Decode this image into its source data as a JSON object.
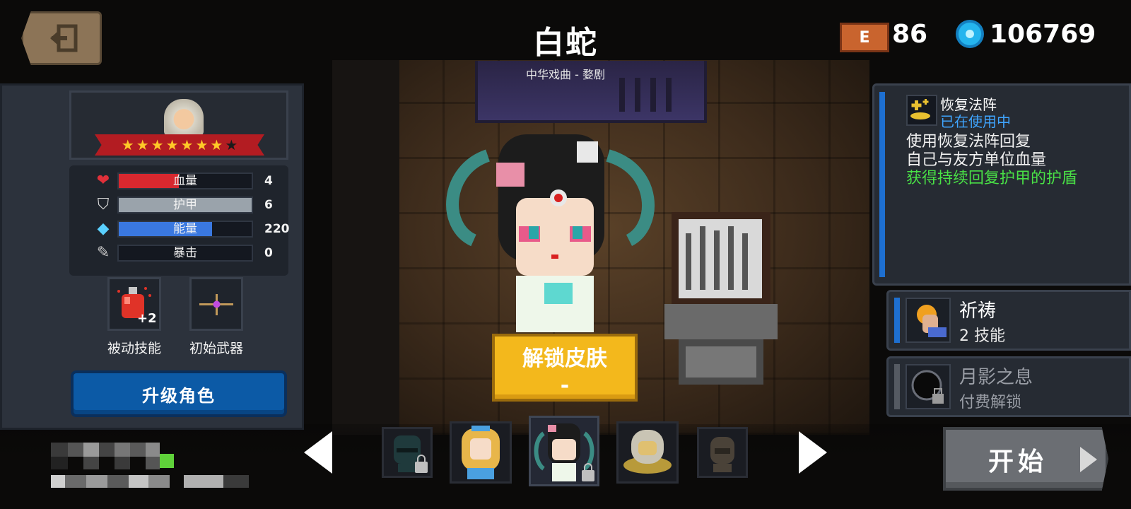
{
  "header": {
    "title": "白蛇",
    "subtitle": "中华戏曲 - 婺剧",
    "gem_icon_label": "E",
    "gem_count": "86",
    "coin_count": "106769"
  },
  "character": {
    "stars_filled": 7,
    "stars_total": 8,
    "stats": [
      {
        "label": "血量",
        "value": "4",
        "icon": "heart-icon",
        "color": "#d8282f",
        "fill": 0.45
      },
      {
        "label": "护甲",
        "value": "6",
        "icon": "shield-icon",
        "color": "#9aa3ab",
        "fill": 1.0
      },
      {
        "label": "能量",
        "value": "220",
        "icon": "energy-gem-icon",
        "color": "#3a78e0",
        "fill": 0.7
      },
      {
        "label": "暴击",
        "value": "0",
        "icon": "crit-blade-icon",
        "color": "#555555",
        "fill": 0.0
      }
    ],
    "passive_skill_label": "被动技能",
    "passive_skill_badge": "+2",
    "start_weapon_label": "初始武器",
    "upgrade_label": "升级角色"
  },
  "skin": {
    "unlock_label": "解锁皮肤",
    "unlock_price": "-"
  },
  "carousel": {
    "slots": [
      {
        "name": "char-slot-ninja",
        "locked": true
      },
      {
        "name": "char-slot-alice",
        "locked": false
      },
      {
        "name": "char-slot-white-snake",
        "locked": true,
        "selected": true
      },
      {
        "name": "char-slot-astronaut",
        "locked": false
      },
      {
        "name": "char-slot-dark-knight",
        "locked": false
      }
    ]
  },
  "skill": {
    "name": "恢复法阵",
    "status": "已在使用中",
    "desc_line1": "使用恢复法阵回复",
    "desc_line2": "自己与友方单位血量",
    "desc_line3": "获得持续回复护甲的护盾"
  },
  "abilities": [
    {
      "title": "祈祷",
      "subtitle": "2 技能",
      "icon": "praying-hand-icon",
      "accent": "#1e6fd0"
    },
    {
      "title": "月影之息",
      "subtitle": "付费解锁",
      "icon": "moon-shadow-icon",
      "accent": "#555a62"
    }
  ],
  "start_label": "开始"
}
